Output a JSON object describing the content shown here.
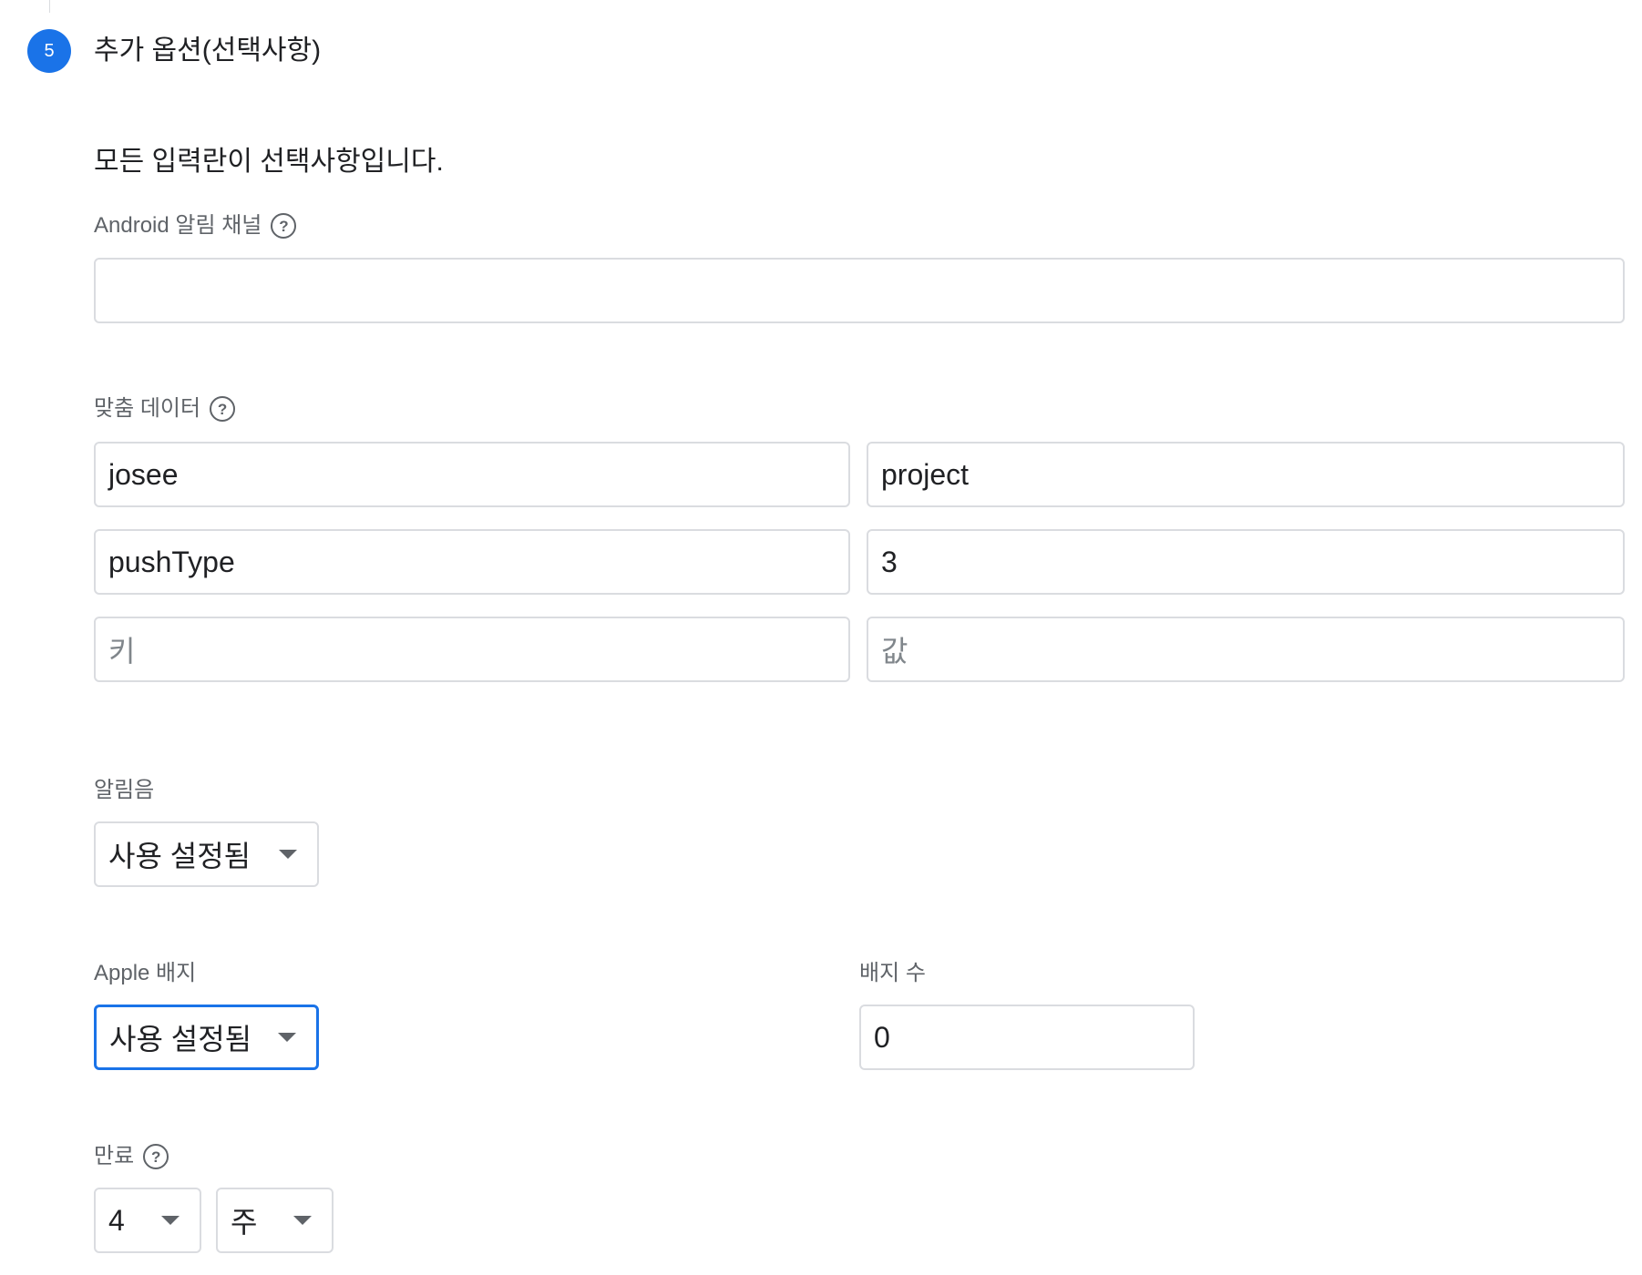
{
  "step": {
    "number": "5",
    "title": "추가 옵션(선택사항)"
  },
  "intro": "모든 입력란이 선택사항입니다.",
  "android_channel": {
    "label": "Android 알림 채널",
    "value": ""
  },
  "custom_data": {
    "label": "맞춤 데이터",
    "rows": [
      {
        "key": "josee",
        "value": "project"
      },
      {
        "key": "pushType",
        "value": "3"
      }
    ],
    "key_placeholder": "키",
    "value_placeholder": "값"
  },
  "sound": {
    "label": "알림음",
    "selected": "사용 설정됨"
  },
  "apple_badge": {
    "label": "Apple 배지",
    "selected": "사용 설정됨"
  },
  "badge_count": {
    "label": "배지 수",
    "value": "0"
  },
  "expiry": {
    "label": "만료",
    "amount": "4",
    "unit": "주"
  },
  "colors": {
    "accent": "#1a73e8",
    "border": "#dadce0",
    "label": "#5f6368"
  }
}
